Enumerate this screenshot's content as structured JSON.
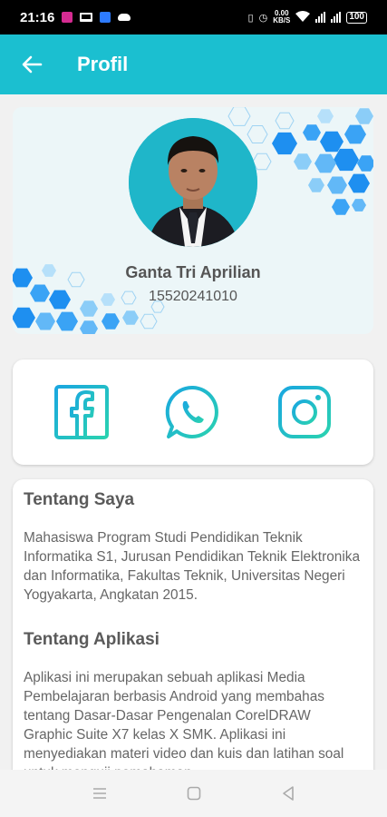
{
  "status_bar": {
    "time": "21:16",
    "data_speed_top": "0.00",
    "data_speed_bottom": "KB/S",
    "battery": "100"
  },
  "app_bar": {
    "title": "Profil",
    "back_icon": "arrow-left-icon"
  },
  "profile": {
    "name": "Ganta Tri Aprilian",
    "nim": "15520241010"
  },
  "social": [
    {
      "name": "facebook-icon"
    },
    {
      "name": "whatsapp-icon"
    },
    {
      "name": "instagram-icon"
    }
  ],
  "about_me": {
    "heading": "Tentang Saya",
    "body": "Mahasiswa Program Studi Pendidikan Teknik Informatika S1, Jurusan Pendidikan Teknik Elektronika dan Informatika, Fakultas Teknik, Universitas Negeri Yogyakarta, Angkatan 2015."
  },
  "about_app": {
    "heading": "Tentang Aplikasi",
    "body": "Aplikasi ini merupakan sebuah aplikasi Media Pembelajaran berbasis Android yang membahas tentang Dasar-Dasar Pengenalan CorelDRAW Graphic Suite X7 kelas X SMK. Aplikasi ini menyediakan materi video dan kuis dan latihan soal untuk menguji pemahaman."
  },
  "colors": {
    "accent": "#1bbfd0",
    "icon_gradient_start": "#1aa7e0",
    "icon_gradient_end": "#2ad2b0"
  }
}
